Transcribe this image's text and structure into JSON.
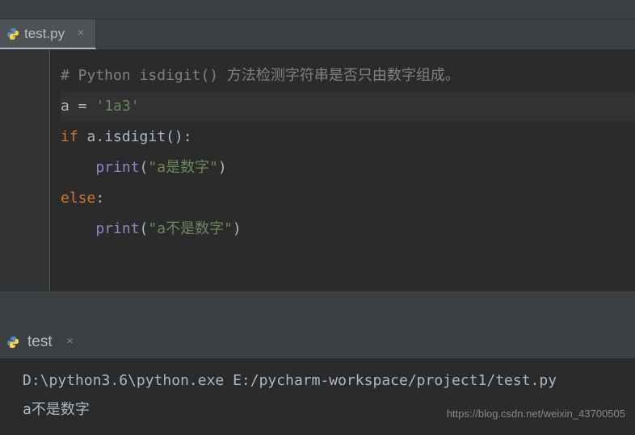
{
  "tab": {
    "filename": "test.py"
  },
  "code": {
    "line1_comment": "# Python isdigit() 方法检测字符串是否只由数字组成。",
    "line2_var": "a",
    "line2_assign": " = ",
    "line2_str": "'1a3'",
    "line3_keyword": "if",
    "line3_expr1": " a.",
    "line3_method": "isdigit",
    "line3_expr2": "():",
    "line4_indent": "    ",
    "line4_print": "print",
    "line4_open": "(",
    "line4_str": "\"a是数字\"",
    "line4_close": ")",
    "line5_keyword": "else",
    "line5_colon": ":",
    "line6_indent": "    ",
    "line6_print": "print",
    "line6_open": "(",
    "line6_str": "\"a不是数字\"",
    "line6_close": ")"
  },
  "run": {
    "label": "test"
  },
  "console": {
    "line1": "D:\\python3.6\\python.exe E:/pycharm-workspace/project1/test.py",
    "line2": "a不是数字"
  },
  "watermark": "https://blog.csdn.net/weixin_43700505"
}
